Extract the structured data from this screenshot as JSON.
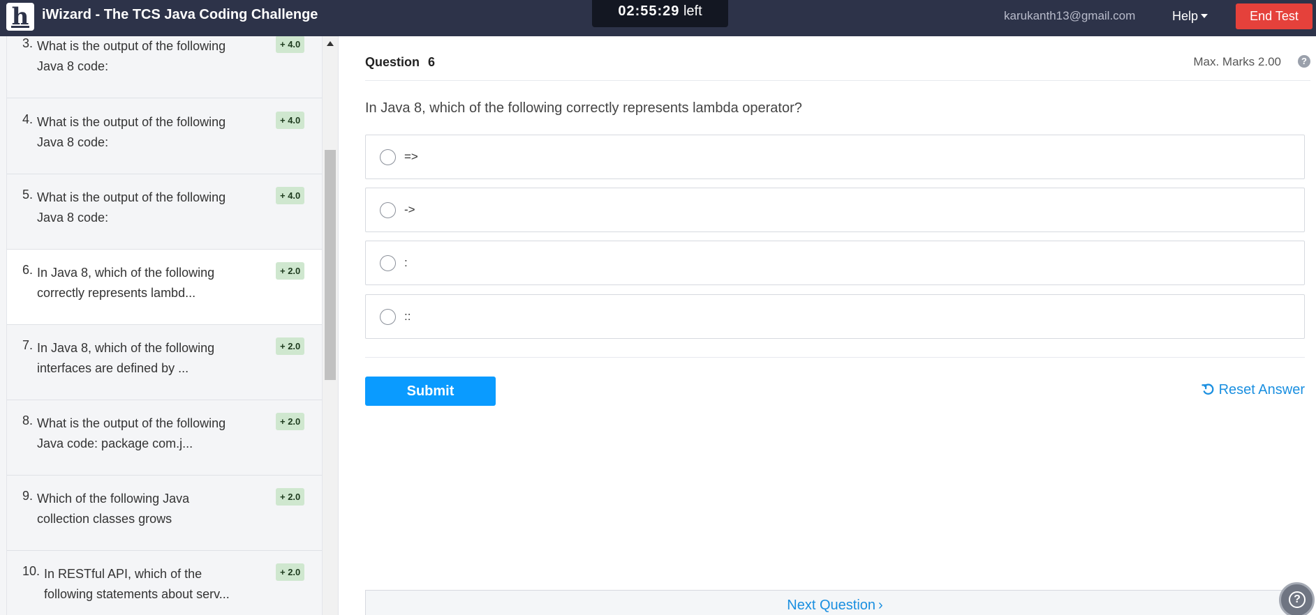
{
  "header": {
    "app_title": "iWizard - The TCS Java Coding Challenge",
    "logo_letter": "h",
    "timer_value": "02:55:29",
    "timer_suffix": "left",
    "user_email": "karukanth13@gmail.com",
    "help_label": "Help",
    "end_test_label": "End Test"
  },
  "sidebar": {
    "questions": [
      {
        "number": "3.",
        "text": "What is the output of the following Java 8 code:",
        "marks": "+ 4.0"
      },
      {
        "number": "4.",
        "text": "What is the output of the following Java 8 code:",
        "marks": "+ 4.0"
      },
      {
        "number": "5.",
        "text": "What is the output of the following Java 8 code:",
        "marks": "+ 4.0"
      },
      {
        "number": "6.",
        "text": "In Java 8, which of the following correctly represents lambd...",
        "marks": "+ 2.0"
      },
      {
        "number": "7.",
        "text": "In Java 8, which of the following interfaces are defined by ...",
        "marks": "+ 2.0"
      },
      {
        "number": "8.",
        "text": "What is the output of the following Java code: package com.j...",
        "marks": "+ 2.0"
      },
      {
        "number": "9.",
        "text": "Which of the following Java collection classes grows",
        "marks": "+ 2.0"
      },
      {
        "number": "10.",
        "text": "In RESTful API, which of the following statements about serv...",
        "marks": "+ 2.0"
      }
    ]
  },
  "question": {
    "label": "Question",
    "number": "6",
    "max_marks": "Max. Marks 2.00",
    "help_glyph": "?",
    "statement": "In Java 8, which of the following correctly represents lambda operator?",
    "options": [
      "=>",
      "->",
      ":",
      "::"
    ],
    "submit_label": "Submit",
    "reset_label": "Reset Answer",
    "next_label": "Next Question",
    "next_chevron": "›"
  },
  "chat": {
    "glyph": "?"
  },
  "colors": {
    "header_bg": "#2d3349",
    "end_test": "#e5413b",
    "submit": "#0a9bff",
    "link": "#1a8fe0",
    "marks_badge": "#cfe7cf"
  },
  "icons": {
    "help_caret": "chevron-down-icon",
    "question_help": "help-circle-icon",
    "reset": "undo-icon",
    "chat": "help-chat-icon"
  }
}
